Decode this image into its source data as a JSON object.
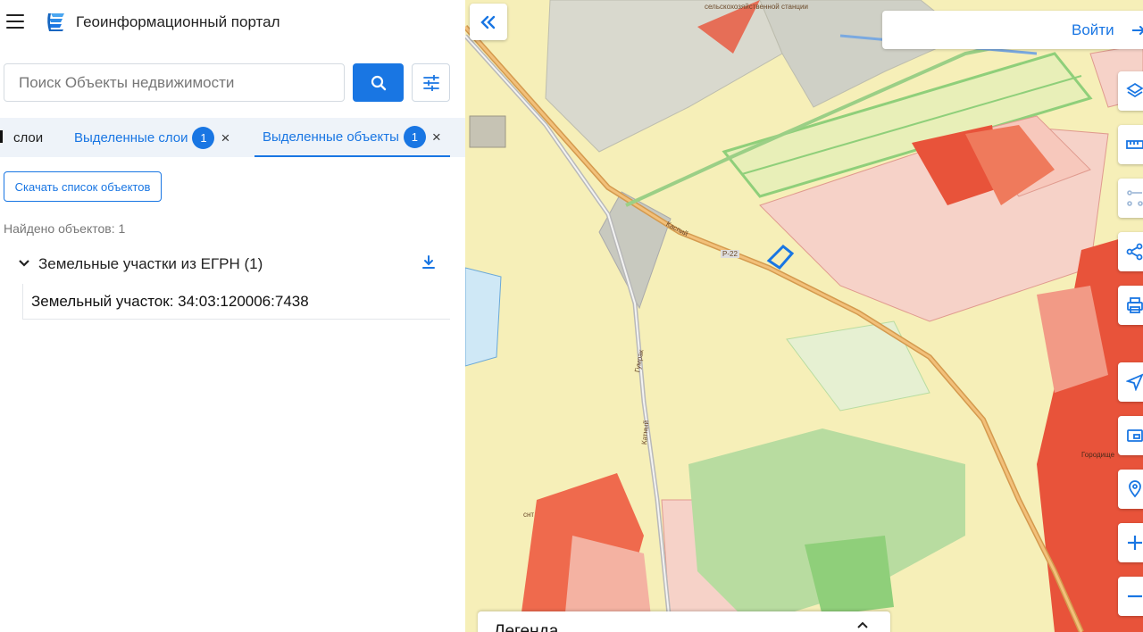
{
  "header": {
    "title": "Геоинформационный портал",
    "menu_icon": "hamburger-menu-icon",
    "logo_icon": "portal-logo-icon"
  },
  "search": {
    "placeholder": "Поиск Объекты недвижимости",
    "value": "",
    "search_icon": "search-icon",
    "filter_icon": "sliders-icon"
  },
  "tabs": [
    {
      "label": "слои",
      "badge": null,
      "active": false
    },
    {
      "label": "Выделенные слои",
      "badge": "1",
      "active": false,
      "close": "×"
    },
    {
      "label": "Выделенные объекты",
      "badge": "1",
      "active": true,
      "close": "×"
    }
  ],
  "results": {
    "download_button": "Скачать список объектов",
    "found_text": "Найдено объектов: 1",
    "group_title": "Земельные участки из ЕГРН (1)",
    "items": [
      {
        "label": "Земельный участок: 34:03:120006:7438"
      }
    ]
  },
  "map": {
    "login_label": "Войти",
    "legend_title": "Легенда",
    "labels": {
      "settlement": "сельскохозяйственной станции",
      "road_caspian": "Каспий",
      "road_code": "Р-22",
      "road_gumrak": "Гумрак",
      "road_katnyi": "Катный",
      "town": "Городище",
      "snt": "снт"
    },
    "tools": [
      "layers-icon",
      "ruler-icon",
      "selection-icon",
      "share-icon",
      "print-icon",
      "locate-icon",
      "map-frame-icon",
      "pin-search-icon",
      "zoom-in-icon",
      "zoom-out-icon"
    ],
    "colors": {
      "accent": "#1976e3",
      "land_yellow": "#f6efb8",
      "urban_red": "#e8533a",
      "parcel_pink": "#f6d2c8",
      "green": "#a6d38a",
      "gray": "#d2d2c8"
    }
  }
}
